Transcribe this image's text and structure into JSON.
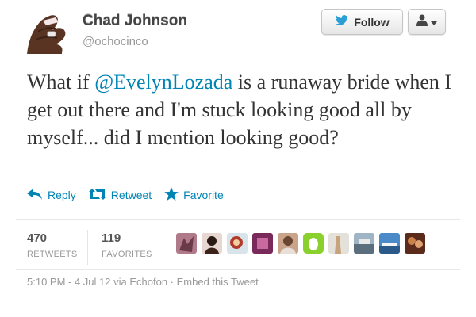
{
  "user": {
    "name": "Chad Johnson",
    "handle": "@ochocinco"
  },
  "buttons": {
    "follow_label": "Follow",
    "user_menu_icon": "user-dropdown-icon",
    "follow_icon": "twitter-bird-icon"
  },
  "tweet": {
    "text_before": "What if ",
    "mention": "@EvelynLozada",
    "text_after": " is a runaway bride when I get out there and I'm stuck looking good all by myself... did I mention looking good?"
  },
  "actions": {
    "reply": "Reply",
    "retweet": "Retweet",
    "favorite": "Favorite"
  },
  "stats": {
    "retweets_count": "470",
    "retweets_label": "RETWEETS",
    "favorites_count": "119",
    "favorites_label": "FAVORITES"
  },
  "favoriters": [
    {
      "icon": "user-avatar-icon"
    },
    {
      "icon": "user-avatar-icon"
    },
    {
      "icon": "user-avatar-icon"
    },
    {
      "icon": "user-avatar-icon"
    },
    {
      "icon": "user-avatar-icon"
    },
    {
      "icon": "user-avatar-icon"
    },
    {
      "icon": "user-avatar-icon"
    },
    {
      "icon": "user-avatar-icon"
    },
    {
      "icon": "user-avatar-icon"
    },
    {
      "icon": "user-avatar-icon"
    }
  ],
  "meta": {
    "time": "5:10 PM - 4 Jul 12",
    "via_prefix": " via ",
    "client": "Echofon",
    "separator": " · ",
    "embed": "Embed this Tweet"
  },
  "colors": {
    "link": "#0084b4",
    "text": "#333333",
    "muted": "#999999"
  }
}
